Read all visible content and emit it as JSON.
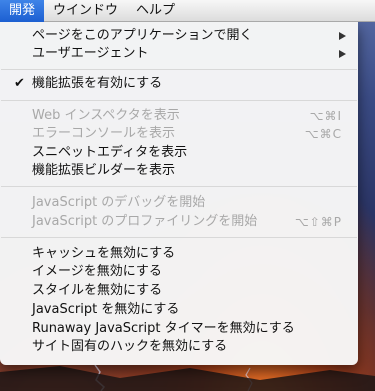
{
  "menubar": {
    "items": [
      {
        "label": "開発",
        "active": true
      },
      {
        "label": "ウインドウ",
        "active": false
      },
      {
        "label": "ヘルプ",
        "active": false
      }
    ]
  },
  "menu": {
    "items": [
      {
        "label": "ページをこのアプリケーションで開く",
        "submenu": true,
        "enabled": true
      },
      {
        "label": "ユーザエージェント",
        "submenu": true,
        "enabled": true
      },
      {
        "label": "機能拡張を有効にする",
        "checked": true,
        "enabled": true
      },
      {
        "label": "Web インスペクタを表示",
        "shortcut": "⌥⌘I",
        "enabled": false
      },
      {
        "label": "エラーコンソールを表示",
        "shortcut": "⌥⌘C",
        "enabled": false
      },
      {
        "label": "スニペットエディタを表示",
        "enabled": true
      },
      {
        "label": "機能拡張ビルダーを表示",
        "enabled": true
      },
      {
        "label": "JavaScript のデバッグを開始",
        "enabled": false
      },
      {
        "label": "JavaScript のプロファイリングを開始",
        "shortcut": "⌥⇧⌘P",
        "enabled": false
      },
      {
        "label": "キャッシュを無効にする",
        "enabled": true
      },
      {
        "label": "イメージを無効にする",
        "enabled": true
      },
      {
        "label": "スタイルを無効にする",
        "enabled": true
      },
      {
        "label": "JavaScript を無効にする",
        "enabled": true
      },
      {
        "label": "Runaway JavaScript タイマーを無効にする",
        "enabled": true
      },
      {
        "label": "サイト固有のハックを無効にする",
        "enabled": true
      }
    ],
    "checkmark": "✔"
  }
}
